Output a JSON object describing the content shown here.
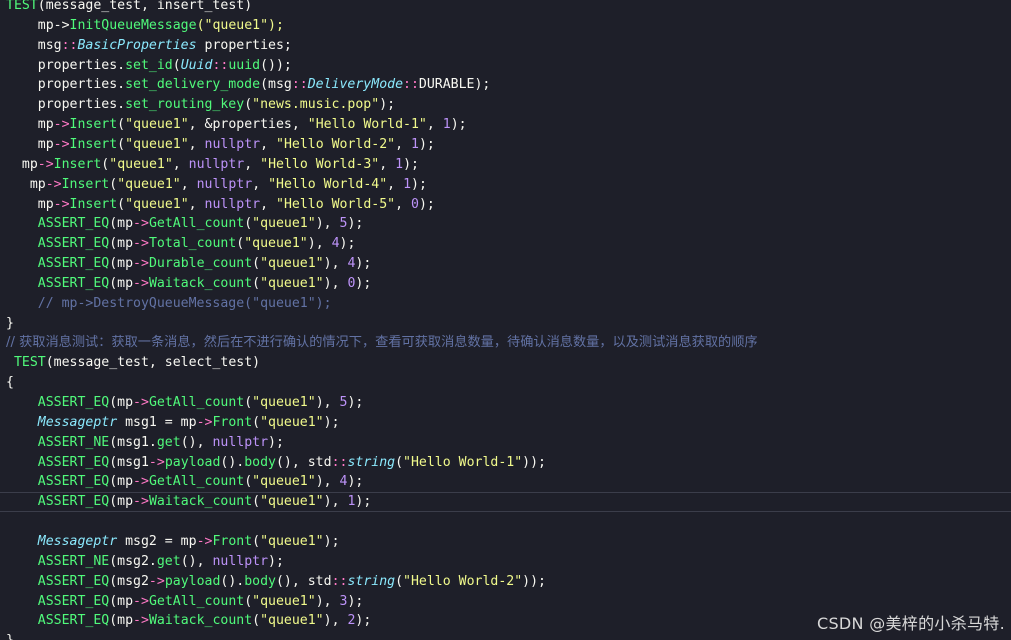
{
  "editor": {
    "lines": [
      [
        [
          "TEST",
          "func"
        ],
        [
          "(message_test, insert_test)",
          "plain"
        ]
      ],
      [
        [
          "    mp->",
          "plain"
        ],
        [
          "InitQueueMessage",
          "func"
        ],
        [
          "(\"queue1\");",
          "string"
        ]
      ],
      [
        [
          "    msg",
          "plain"
        ],
        [
          "::",
          "op"
        ],
        [
          "BasicProperties",
          "type"
        ],
        [
          " properties;",
          "plain"
        ]
      ],
      [
        [
          "    properties.",
          "plain"
        ],
        [
          "set_id",
          "func"
        ],
        [
          "(",
          "punct"
        ],
        [
          "Uuid",
          "type"
        ],
        [
          "::",
          "op"
        ],
        [
          "uuid",
          "func"
        ],
        [
          "());",
          "punct"
        ]
      ],
      [
        [
          "    properties.",
          "plain"
        ],
        [
          "set_delivery_mode",
          "func"
        ],
        [
          "(msg",
          "plain"
        ],
        [
          "::",
          "op"
        ],
        [
          "DeliveryMode",
          "type"
        ],
        [
          "::",
          "op"
        ],
        [
          "DURABLE",
          "plain"
        ],
        [
          ");",
          "punct"
        ]
      ],
      [
        [
          "    properties.",
          "plain"
        ],
        [
          "set_routing_key",
          "func"
        ],
        [
          "(",
          "punct"
        ],
        [
          "\"news.music.pop\"",
          "string"
        ],
        [
          ");",
          "punct"
        ]
      ],
      [
        [
          "    mp",
          "plain"
        ],
        [
          "->",
          "op"
        ],
        [
          "Insert",
          "func"
        ],
        [
          "(",
          "punct"
        ],
        [
          "\"queue1\"",
          "string"
        ],
        [
          ", &properties, ",
          "plain"
        ],
        [
          "\"Hello World-1\"",
          "string"
        ],
        [
          ", ",
          "plain"
        ],
        [
          "1",
          "number"
        ],
        [
          ");",
          "punct"
        ]
      ],
      [
        [
          "    mp",
          "plain"
        ],
        [
          "->",
          "op"
        ],
        [
          "Insert",
          "func"
        ],
        [
          "(",
          "punct"
        ],
        [
          "\"queue1\"",
          "string"
        ],
        [
          ", ",
          "plain"
        ],
        [
          "nullptr",
          "const"
        ],
        [
          ", ",
          "plain"
        ],
        [
          "\"Hello World-2\"",
          "string"
        ],
        [
          ", ",
          "plain"
        ],
        [
          "1",
          "number"
        ],
        [
          ");",
          "punct"
        ]
      ],
      [
        [
          "  mp",
          "plain"
        ],
        [
          "->",
          "op"
        ],
        [
          "Insert",
          "func"
        ],
        [
          "(",
          "punct"
        ],
        [
          "\"queue1\"",
          "string"
        ],
        [
          ", ",
          "plain"
        ],
        [
          "nullptr",
          "const"
        ],
        [
          ", ",
          "plain"
        ],
        [
          "\"Hello World-3\"",
          "string"
        ],
        [
          ", ",
          "plain"
        ],
        [
          "1",
          "number"
        ],
        [
          ");",
          "punct"
        ]
      ],
      [
        [
          "   mp",
          "plain"
        ],
        [
          "->",
          "op"
        ],
        [
          "Insert",
          "func"
        ],
        [
          "(",
          "punct"
        ],
        [
          "\"queue1\"",
          "string"
        ],
        [
          ", ",
          "plain"
        ],
        [
          "nullptr",
          "const"
        ],
        [
          ", ",
          "plain"
        ],
        [
          "\"Hello World-4\"",
          "string"
        ],
        [
          ", ",
          "plain"
        ],
        [
          "1",
          "number"
        ],
        [
          ");",
          "punct"
        ]
      ],
      [
        [
          "    mp",
          "plain"
        ],
        [
          "->",
          "op"
        ],
        [
          "Insert",
          "func"
        ],
        [
          "(",
          "punct"
        ],
        [
          "\"queue1\"",
          "string"
        ],
        [
          ", ",
          "plain"
        ],
        [
          "nullptr",
          "const"
        ],
        [
          ", ",
          "plain"
        ],
        [
          "\"Hello World-5\"",
          "string"
        ],
        [
          ", ",
          "plain"
        ],
        [
          "0",
          "number"
        ],
        [
          ");",
          "punct"
        ]
      ],
      [
        [
          "    ASSERT_EQ",
          "func"
        ],
        [
          "(mp",
          "plain"
        ],
        [
          "->",
          "op"
        ],
        [
          "GetAll_count",
          "func"
        ],
        [
          "(",
          "punct"
        ],
        [
          "\"queue1\"",
          "string"
        ],
        [
          "), ",
          "punct"
        ],
        [
          "5",
          "number"
        ],
        [
          ");",
          "punct"
        ]
      ],
      [
        [
          "    ASSERT_EQ",
          "func"
        ],
        [
          "(mp",
          "plain"
        ],
        [
          "->",
          "op"
        ],
        [
          "Total_count",
          "func"
        ],
        [
          "(",
          "punct"
        ],
        [
          "\"queue1\"",
          "string"
        ],
        [
          "), ",
          "punct"
        ],
        [
          "4",
          "number"
        ],
        [
          ");",
          "punct"
        ]
      ],
      [
        [
          "    ASSERT_EQ",
          "func"
        ],
        [
          "(mp",
          "plain"
        ],
        [
          "->",
          "op"
        ],
        [
          "Durable_count",
          "func"
        ],
        [
          "(",
          "punct"
        ],
        [
          "\"queue1\"",
          "string"
        ],
        [
          "), ",
          "punct"
        ],
        [
          "4",
          "number"
        ],
        [
          ");",
          "punct"
        ]
      ],
      [
        [
          "    ASSERT_EQ",
          "func"
        ],
        [
          "(mp",
          "plain"
        ],
        [
          "->",
          "op"
        ],
        [
          "Waitack_count",
          "func"
        ],
        [
          "(",
          "punct"
        ],
        [
          "\"queue1\"",
          "string"
        ],
        [
          "), ",
          "punct"
        ],
        [
          "0",
          "number"
        ],
        [
          ");",
          "punct"
        ]
      ],
      [
        [
          "    // mp->DestroyQueueMessage(\"queue1\");",
          "comment"
        ]
      ],
      [
        [
          "}",
          "punct"
        ]
      ],
      [
        [
          "// 获取消息测试：获取一条消息，然后在不进行确认的情况下，查看可获取消息数量，待确认消息数量，以及测试消息获取的顺序",
          "cn-comment"
        ]
      ],
      [
        [
          " TEST",
          "func"
        ],
        [
          "(message_test, select_test)",
          "plain"
        ]
      ],
      [
        [
          "{",
          "punct"
        ]
      ],
      [
        [
          "    ASSERT_EQ",
          "func"
        ],
        [
          "(mp",
          "plain"
        ],
        [
          "->",
          "op"
        ],
        [
          "GetAll_count",
          "func"
        ],
        [
          "(",
          "punct"
        ],
        [
          "\"queue1\"",
          "string"
        ],
        [
          "), ",
          "punct"
        ],
        [
          "5",
          "number"
        ],
        [
          ");",
          "punct"
        ]
      ],
      [
        [
          "    Messageptr",
          "type"
        ],
        [
          " msg1 = mp",
          "plain"
        ],
        [
          "->",
          "op"
        ],
        [
          "Front",
          "func"
        ],
        [
          "(",
          "punct"
        ],
        [
          "\"queue1\"",
          "string"
        ],
        [
          ");",
          "punct"
        ]
      ],
      [
        [
          "    ASSERT_NE",
          "func"
        ],
        [
          "(msg1.",
          "plain"
        ],
        [
          "get",
          "func"
        ],
        [
          "(), ",
          "punct"
        ],
        [
          "nullptr",
          "const"
        ],
        [
          ");",
          "punct"
        ]
      ],
      [
        [
          "    ASSERT_EQ",
          "func"
        ],
        [
          "(msg1",
          "plain"
        ],
        [
          "->",
          "op"
        ],
        [
          "payload",
          "func"
        ],
        [
          "().",
          "punct"
        ],
        [
          "body",
          "func"
        ],
        [
          "(), std",
          "punct"
        ],
        [
          "::",
          "op"
        ],
        [
          "string",
          "type"
        ],
        [
          "(",
          "punct"
        ],
        [
          "\"Hello World-1\"",
          "string"
        ],
        [
          "));",
          "punct"
        ]
      ],
      [
        [
          "    ASSERT_EQ",
          "func"
        ],
        [
          "(mp",
          "plain"
        ],
        [
          "->",
          "op"
        ],
        [
          "GetAll_count",
          "func"
        ],
        [
          "(",
          "punct"
        ],
        [
          "\"queue1\"",
          "string"
        ],
        [
          "), ",
          "punct"
        ],
        [
          "4",
          "number"
        ],
        [
          ");",
          "punct"
        ]
      ],
      [
        [
          "    ASSERT_EQ",
          "func"
        ],
        [
          "(mp",
          "plain"
        ],
        [
          "->",
          "op"
        ],
        [
          "Waitack_count",
          "func"
        ],
        [
          "(",
          "punct"
        ],
        [
          "\"queue1\"",
          "string"
        ],
        [
          "), ",
          "punct"
        ],
        [
          "1",
          "number"
        ],
        [
          ");",
          "punct"
        ]
      ],
      [
        [
          "",
          "plain"
        ]
      ],
      [
        [
          "    Messageptr",
          "type"
        ],
        [
          " msg2 = mp",
          "plain"
        ],
        [
          "->",
          "op"
        ],
        [
          "Front",
          "func"
        ],
        [
          "(",
          "punct"
        ],
        [
          "\"queue1\"",
          "string"
        ],
        [
          ");",
          "punct"
        ]
      ],
      [
        [
          "    ASSERT_NE",
          "func"
        ],
        [
          "(msg2.",
          "plain"
        ],
        [
          "get",
          "func"
        ],
        [
          "(), ",
          "punct"
        ],
        [
          "nullptr",
          "const"
        ],
        [
          ");",
          "punct"
        ]
      ],
      [
        [
          "    ASSERT_EQ",
          "func"
        ],
        [
          "(msg2",
          "plain"
        ],
        [
          "->",
          "op"
        ],
        [
          "payload",
          "func"
        ],
        [
          "().",
          "punct"
        ],
        [
          "body",
          "func"
        ],
        [
          "(), std",
          "punct"
        ],
        [
          "::",
          "op"
        ],
        [
          "string",
          "type"
        ],
        [
          "(",
          "punct"
        ],
        [
          "\"Hello World-2\"",
          "string"
        ],
        [
          "));",
          "punct"
        ]
      ],
      [
        [
          "    ASSERT_EQ",
          "func"
        ],
        [
          "(mp",
          "plain"
        ],
        [
          "->",
          "op"
        ],
        [
          "GetAll_count",
          "func"
        ],
        [
          "(",
          "punct"
        ],
        [
          "\"queue1\"",
          "string"
        ],
        [
          "), ",
          "punct"
        ],
        [
          "3",
          "number"
        ],
        [
          ");",
          "punct"
        ]
      ],
      [
        [
          "    ASSERT_EQ",
          "func"
        ],
        [
          "(mp",
          "plain"
        ],
        [
          "->",
          "op"
        ],
        [
          "Waitack_count",
          "func"
        ],
        [
          "(",
          "punct"
        ],
        [
          "\"queue1\"",
          "string"
        ],
        [
          "), ",
          "punct"
        ],
        [
          "2",
          "number"
        ],
        [
          ");",
          "punct"
        ]
      ],
      [
        [
          "}",
          "punct"
        ]
      ]
    ],
    "current_line_index": 25
  },
  "watermark": "CSDN @美梓的小杀马特."
}
